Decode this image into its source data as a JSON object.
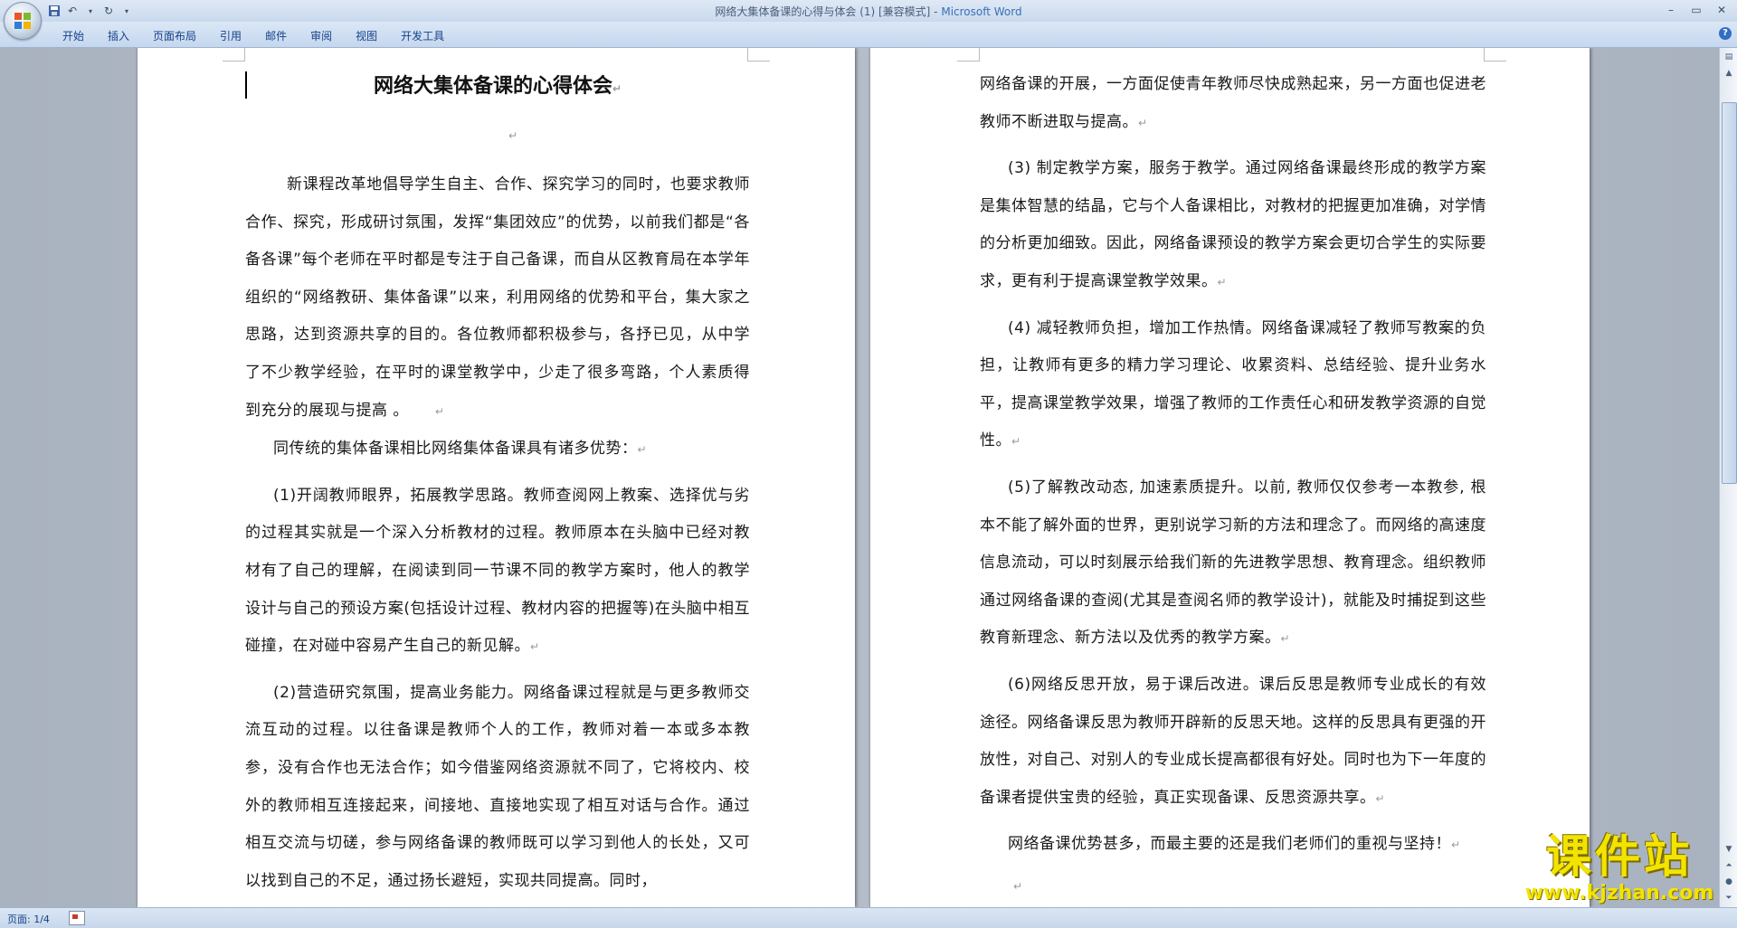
{
  "window": {
    "title": "网络大集体备课的心得与体会 (1) [兼容模式] -",
    "app_name": "Microsoft Word"
  },
  "ribbon": {
    "tabs": [
      "开始",
      "插入",
      "页面布局",
      "引用",
      "邮件",
      "审阅",
      "视图",
      "开发工具"
    ]
  },
  "document": {
    "title": "网络大集体备课的心得体会",
    "page1_paragraphs": [
      "新课程改革地倡导学生自主、合作、探究学习的同时，也要求教师合作、探究，形成研讨氛围，发挥“集团效应”的优势，以前我们都是“各备各课”每个老师在平时都是专注于自己备课，而自从区教育局在本学年组织的“网络教研、集体备课”以来，利用网络的优势和平台，集大家之思路，达到资源共享的目的。各位教师都积极参与，各抒已见，从中学了不少教学经验，在平时的课堂教学中，少走了很多弯路，个人素质得到充分的展现与提高 。",
      "同传统的集体备课相比网络集体备课具有诸多优势：",
      "(1)开阔教师眼界，拓展教学思路。教师查阅网上教案、选择优与劣的过程其实就是一个深入分析教材的过程。教师原本在头脑中已经对教材有了自己的理解，在阅读到同一节课不同的教学方案时，他人的教学设计与自己的预设方案(包括设计过程、教材内容的把握等)在头脑中相互碰撞，在对碰中容易产生自己的新见解。",
      "(2)营造研究氛围，提高业务能力。网络备课过程就是与更多教师交流互动的过程。以往备课是教师个人的工作，教师对着一本或多本教参，没有合作也无法合作；如今借鉴网络资源就不同了，它将校内、校外的教师相互连接起来，间接地、直接地实现了相互对话与合作。通过相互交流与切磋，参与网络备课的教师既可以学习到他人的长处，又可以找到自己的不足，通过扬长避短，实现共同提高。同时，"
    ],
    "page2_paragraphs": [
      "网络备课的开展，一方面促使青年教师尽快成熟起来，另一方面也促进老教师不断进取与提高。",
      "(3) 制定教学方案，服务于教学。通过网络备课最终形成的教学方案是集体智慧的结晶，它与个人备课相比，对教材的把握更加准确，对学情的分析更加细致。因此，网络备课预设的教学方案会更切合学生的实际要求，更有利于提高课堂教学效果。",
      "(4) 减轻教师负担，增加工作热情。网络备课减轻了教师写教案的负担，让教师有更多的精力学习理论、收累资料、总结经验、提升业务水平，提高课堂教学效果，增强了教师的工作责任心和研发教学资源的自觉性。",
      "(5)了解教改动态, 加速素质提升。以前, 教师仅仅参考一本教参, 根本不能了解外面的世界，更别说学习新的方法和理念了。而网络的高速度信息流动，可以时刻展示给我们新的先进教学思想、教育理念。组织教师通过网络备课的查阅(尤其是查阅名师的教学设计)，就能及时捕捉到这些教育新理念、新方法以及优秀的教学方案。",
      "(6)网络反思开放，易于课后改进。课后反思是教师专业成长的有效途径。网络备课反思为教师开辟新的反思天地。这样的反思具有更强的开放性，对自己、对别人的专业成长提高都很有好处。同时也为下一年度的备课者提供宝贵的经验，真正实现备课、反思资源共享。",
      "网络备课优势甚多，而最主要的还是我们老师们的重视与坚持！"
    ]
  },
  "statusbar": {
    "page_info": "页面: 1/4"
  },
  "watermark": {
    "text": "课件站",
    "url": "www.kjzhan.com"
  }
}
